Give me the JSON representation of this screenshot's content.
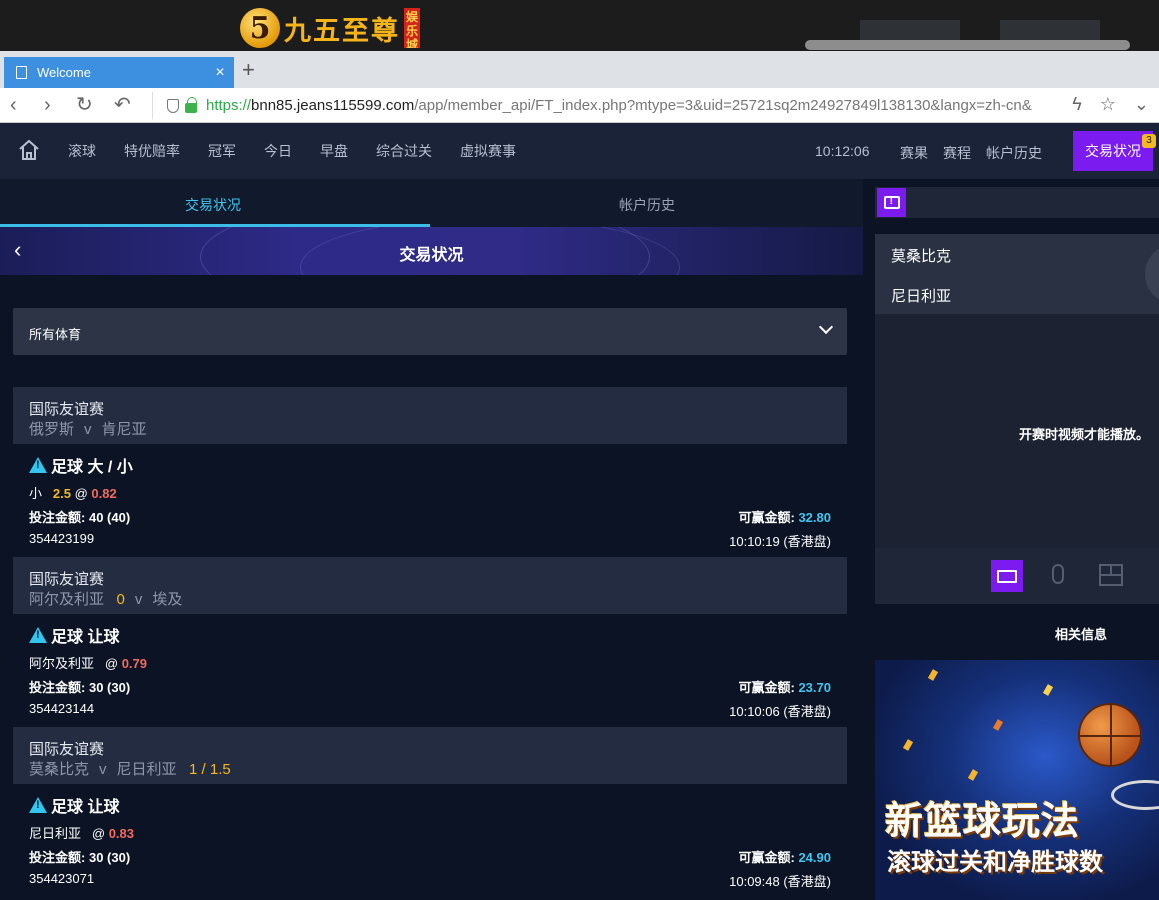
{
  "banner": {
    "logo_mark": "5",
    "logo_text": "九五至尊",
    "logo_tag": "娱乐城"
  },
  "browser": {
    "tab_title": "Welcome",
    "url_scheme": "https://",
    "url_host": "bnn85.jeans115599.com",
    "url_path": "/app/member_api/FT_index.php?mtype=3&uid=25721sq2m24927849l138130&langx=zh-cn&"
  },
  "nav": {
    "items": [
      "滚球",
      "特优赔率",
      "冠军",
      "今日",
      "早盘",
      "综合过关",
      "虚拟赛事"
    ],
    "time": "10:12:06",
    "right_items": [
      "赛果",
      "赛程",
      "帐户历史"
    ],
    "active_button": "交易状况",
    "badge_count": "3"
  },
  "subtabs": {
    "active": "交易状况",
    "inactive": "帐户历史"
  },
  "hero_title": "交易状况",
  "sport_filter": "所有体育",
  "bets": [
    {
      "league": "国际友谊赛",
      "home": "俄罗斯",
      "vs": "v",
      "away": "肯尼亚",
      "handicap": "",
      "market": "足球 大 / 小",
      "selection": "小",
      "line": "2.5",
      "at": "@",
      "odds": "0.82",
      "stake_label": "投注金额:",
      "stake": "40 (40)",
      "win_label": "可赢金额:",
      "win": "32.80",
      "ticket": "354423199",
      "time": "10:10:19 (香港盘)"
    },
    {
      "league": "国际友谊赛",
      "home": "阿尔及利亚",
      "vs": "v",
      "away": "埃及",
      "handicap": "0",
      "market": "足球 让球",
      "selection": "阿尔及利亚",
      "line": "",
      "at": "@",
      "odds": "0.79",
      "stake_label": "投注金额:",
      "stake": "30 (30)",
      "win_label": "可赢金额:",
      "win": "23.70",
      "ticket": "354423144",
      "time": "10:10:06 (香港盘)"
    },
    {
      "league": "国际友谊赛",
      "home": "莫桑比克",
      "vs": "v",
      "away": "尼日利亚",
      "handicap": "1 / 1.5",
      "market": "足球 让球",
      "selection": "尼日利亚",
      "line": "",
      "at": "@",
      "odds": "0.83",
      "stake_label": "投注金额:",
      "stake": "30 (30)",
      "win_label": "可赢金额:",
      "win": "24.90",
      "ticket": "354423071",
      "time": "10:09:48 (香港盘)"
    }
  ],
  "video": {
    "team1": "莫桑比克",
    "team2": "尼日利亚",
    "message": "开赛时视频才能播放。"
  },
  "related_info": "相关信息",
  "promo": {
    "title": "新篮球玩法",
    "subtitle": "滚球过关和净胜球数"
  },
  "colors": {
    "accent_purple": "#7b1bf0",
    "accent_cyan": "#42c6f0",
    "odds_red": "#f36a5e",
    "line_yellow": "#f5b820"
  }
}
